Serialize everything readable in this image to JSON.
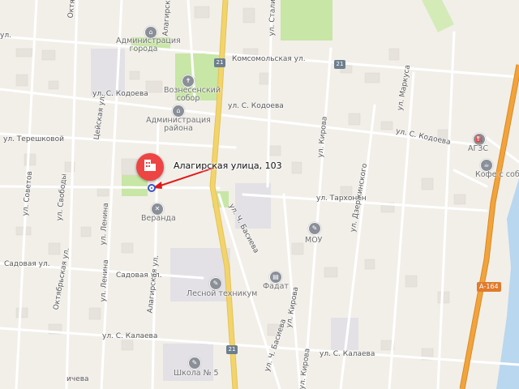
{
  "colors": {
    "background": "#f2efe9",
    "main_road": "#f3d46a",
    "highway": "#f2a33a",
    "park": "#c8e6a5",
    "water": "#b9d7ef",
    "pin": "#ed4543",
    "arrow": "#e01919"
  },
  "marker": {
    "address": "Алагирская улица, 103",
    "icon": "building-icon"
  },
  "streets": {
    "s01": "ул.",
    "s02": "Октябрьская ул.",
    "s03": "Алагирская ул.",
    "s04": "ул. Сталина",
    "s05": "Комсомольская ул.",
    "s06": "ул. С. Кодоева",
    "s07": "ул. С. Кодоева",
    "s08": "ул. С. Кодоева",
    "s09": "ул. Маркуса",
    "s10": "Цейская ул.",
    "s11": "ул. Терешковой",
    "s12": "ул. Кирова",
    "s13": "ул. Тархонон",
    "s14": "ул. Дзержинского",
    "s15": "ул. Советов",
    "s16": "ул. Свободы",
    "s17": "ул. Ленина",
    "s18": "ул. Ленина",
    "s19": "ул. Ч. Басиева",
    "s20": "Садовая ул.",
    "s21": "Садовая ул.",
    "s22": "Октябрьская ул.",
    "s23": "Алагирская ул.",
    "s24": "ул. Кирова",
    "s25": "ул. С. Калаева",
    "s26": "ул. С. Калаева",
    "s27": "ул. Ч. Басиева",
    "s28": "ул. Кирова",
    "s29": "ичева"
  },
  "pois": {
    "p1": "Администрация города",
    "p2": "Вознесенский собор",
    "p3": "Администрация района",
    "p4": "АГЗС",
    "p5": "Кофе с собой",
    "p6": "Веранда",
    "p7": "МОУ",
    "p8": "Лесной техникум",
    "p9": "Фадат",
    "p10": "Школа № 5"
  },
  "route_shields": {
    "r1": "21",
    "r2": "21",
    "r3": "21"
  },
  "highway_shield": "А-164"
}
